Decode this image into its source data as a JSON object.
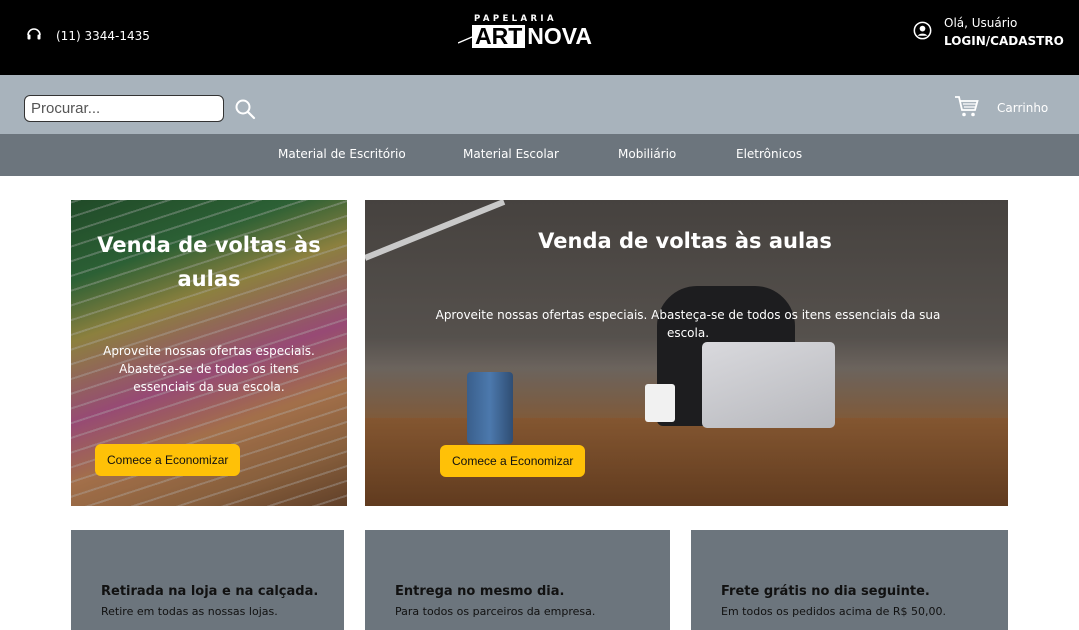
{
  "header": {
    "phone": "(11) 3344-1435",
    "logo_top": "PAPELARIA",
    "logo_art": "ART",
    "logo_nova": "NOVA",
    "greeting": "Olá, Usuário",
    "login": "LOGIN/CADASTRO"
  },
  "search": {
    "placeholder": "Procurar...",
    "value": ""
  },
  "cart": {
    "label": "Carrinho"
  },
  "categories": [
    {
      "label": "Material de Escritório"
    },
    {
      "label": "Material Escolar"
    },
    {
      "label": "Mobiliário"
    },
    {
      "label": "Eletrônicos"
    }
  ],
  "banners": [
    {
      "title": "Venda de voltas às aulas",
      "description": "Aproveite nossas ofertas especiais. Abasteça-se de todos os itens essenciais da sua escola.",
      "cta": "Comece a Economizar"
    },
    {
      "title": "Venda de voltas às aulas",
      "description": "Aproveite nossas ofertas especiais. Abasteça-se de todos os itens essenciais da sua escola.",
      "cta": "Comece a Economizar"
    }
  ],
  "features": [
    {
      "title": "Retirada na loja e na calçada.",
      "text": "Retire em todas as nossas lojas."
    },
    {
      "title": "Entrega no mesmo dia.",
      "text": "Para todos os parceiros da empresa."
    },
    {
      "title": "Frete grátis no dia seguinte.",
      "text": "Em todos os pedidos acima de R$ 50,00."
    }
  ],
  "colors": {
    "header_bg": "#000000",
    "search_bg": "#a8b3bc",
    "nav_bg": "#6c757d",
    "accent": "#ffc107"
  },
  "icons": [
    "headset-icon",
    "user-circle-icon",
    "search-icon",
    "cart-icon"
  ]
}
